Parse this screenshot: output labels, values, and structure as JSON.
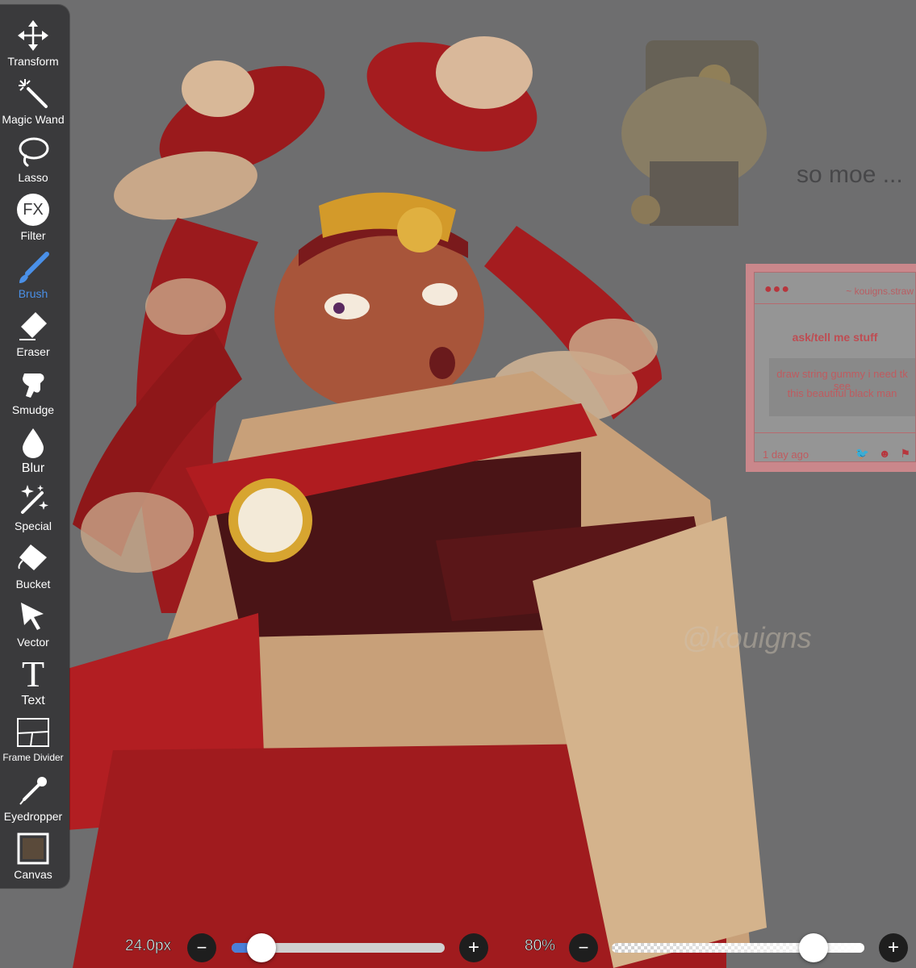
{
  "toolbar": {
    "tools": [
      {
        "label": "Transform",
        "icon": "transform-icon"
      },
      {
        "label": "Magic Wand",
        "icon": "magic-wand-icon"
      },
      {
        "label": "Lasso",
        "icon": "lasso-icon"
      },
      {
        "label": "Filter",
        "icon": "fx-icon",
        "glyph": "FX"
      },
      {
        "label": "Brush",
        "icon": "brush-icon"
      },
      {
        "label": "Eraser",
        "icon": "eraser-icon"
      },
      {
        "label": "Smudge",
        "icon": "smudge-icon"
      },
      {
        "label": "Blur",
        "icon": "blur-icon"
      },
      {
        "label": "Special",
        "icon": "special-icon"
      },
      {
        "label": "Bucket",
        "icon": "bucket-icon"
      },
      {
        "label": "Vector",
        "icon": "vector-icon"
      },
      {
        "label": "Text",
        "icon": "text-icon",
        "glyph": "T"
      },
      {
        "label": "Frame Divider",
        "icon": "frame-divider-icon"
      },
      {
        "label": "Eyedropper",
        "icon": "eyedropper-icon"
      },
      {
        "label": "Canvas",
        "icon": "canvas-icon"
      }
    ],
    "active_tool": "Brush",
    "active_color": "#4a90e8"
  },
  "bottom_bar": {
    "brush_size_label": "24.0px",
    "brush_size_slider_fraction": 0.14,
    "opacity_label": "80%",
    "opacity_slider_fraction": 0.8,
    "minus_glyph": "−",
    "plus_glyph": "+"
  },
  "artwork": {
    "note_text": "so moe ...",
    "watermark": "@kouigns",
    "ask_card": {
      "dots": "●●●",
      "url": "~ kouigns.straw",
      "title": "ask/tell me stuff",
      "question_line1": "draw string gummy i need tk see",
      "question_line2": "this beautiful black man",
      "time": "1 day ago",
      "icons": "🐦 ☻ ⚑"
    }
  }
}
